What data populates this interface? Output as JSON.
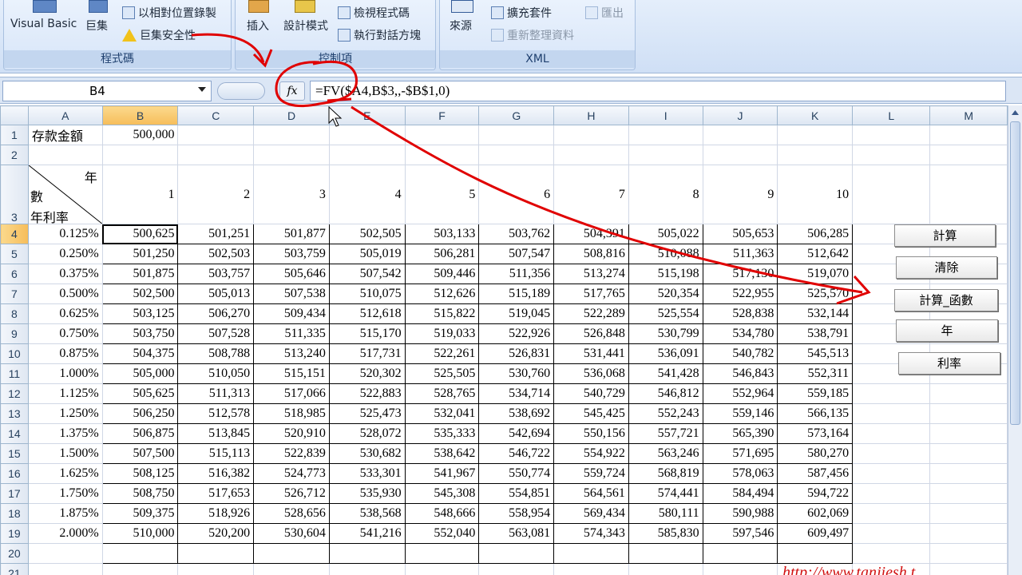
{
  "ribbon": {
    "code_group": {
      "label": "程式碼",
      "visual_basic": "Visual Basic",
      "macros": "巨集",
      "relative_record": "以相對位置錄製",
      "macro_security": "巨集安全性"
    },
    "controls_group": {
      "label": "控制項",
      "insert": "插入",
      "design_mode": "設計模式",
      "view_code": "檢視程式碼",
      "run_dialog": "執行對話方塊"
    },
    "xml_group": {
      "label": "XML",
      "source": "來源",
      "expansion_packs": "擴充套件",
      "refresh_data": "重新整理資料",
      "export": "匯出"
    }
  },
  "formula_bar": {
    "name_box": "B4",
    "fx_label": "fx",
    "formula": "=FV($A4,B$3,,-$B$1,0)"
  },
  "sheet": {
    "columns": [
      "A",
      "B",
      "C",
      "D",
      "E",
      "F",
      "G",
      "H",
      "I",
      "J",
      "K",
      "L",
      "M"
    ],
    "row1": {
      "label": "存款金額",
      "amount": "500,000"
    },
    "row3": {
      "year_label": "年",
      "years_label": "數",
      "rate_label": "年利率",
      "years": [
        "1",
        "2",
        "3",
        "4",
        "5",
        "6",
        "7",
        "8",
        "9",
        "10"
      ]
    },
    "rates": [
      "0.125%",
      "0.250%",
      "0.375%",
      "0.500%",
      "0.625%",
      "0.750%",
      "0.875%",
      "1.000%",
      "1.125%",
      "1.250%",
      "1.375%",
      "1.500%",
      "1.625%",
      "1.750%",
      "1.875%",
      "2.000%"
    ],
    "values": [
      [
        "500,625",
        "501,251",
        "501,877",
        "502,505",
        "503,133",
        "503,762",
        "504,391",
        "505,022",
        "505,653",
        "506,285"
      ],
      [
        "501,250",
        "502,503",
        "503,759",
        "505,019",
        "506,281",
        "507,547",
        "508,816",
        "510,088",
        "511,363",
        "512,642"
      ],
      [
        "501,875",
        "503,757",
        "505,646",
        "507,542",
        "509,446",
        "511,356",
        "513,274",
        "515,198",
        "517,130",
        "519,070"
      ],
      [
        "502,500",
        "505,013",
        "507,538",
        "510,075",
        "512,626",
        "515,189",
        "517,765",
        "520,354",
        "522,955",
        "525,570"
      ],
      [
        "503,125",
        "506,270",
        "509,434",
        "512,618",
        "515,822",
        "519,045",
        "522,289",
        "525,554",
        "528,838",
        "532,144"
      ],
      [
        "503,750",
        "507,528",
        "511,335",
        "515,170",
        "519,033",
        "522,926",
        "526,848",
        "530,799",
        "534,780",
        "538,791"
      ],
      [
        "504,375",
        "508,788",
        "513,240",
        "517,731",
        "522,261",
        "526,831",
        "531,441",
        "536,091",
        "540,782",
        "545,513"
      ],
      [
        "505,000",
        "510,050",
        "515,151",
        "520,302",
        "525,505",
        "530,760",
        "536,068",
        "541,428",
        "546,843",
        "552,311"
      ],
      [
        "505,625",
        "511,313",
        "517,066",
        "522,883",
        "528,765",
        "534,714",
        "540,729",
        "546,812",
        "552,964",
        "559,185"
      ],
      [
        "506,250",
        "512,578",
        "518,985",
        "525,473",
        "532,041",
        "538,692",
        "545,425",
        "552,243",
        "559,146",
        "566,135"
      ],
      [
        "506,875",
        "513,845",
        "520,910",
        "528,072",
        "535,333",
        "542,694",
        "550,156",
        "557,721",
        "565,390",
        "573,164"
      ],
      [
        "507,500",
        "515,113",
        "522,839",
        "530,682",
        "538,642",
        "546,722",
        "554,922",
        "563,246",
        "571,695",
        "580,270"
      ],
      [
        "508,125",
        "516,382",
        "524,773",
        "533,301",
        "541,967",
        "550,774",
        "559,724",
        "568,819",
        "578,063",
        "587,456"
      ],
      [
        "508,750",
        "517,653",
        "526,712",
        "535,930",
        "545,308",
        "554,851",
        "564,561",
        "574,441",
        "584,494",
        "594,722"
      ],
      [
        "509,375",
        "518,926",
        "528,656",
        "538,568",
        "548,666",
        "558,954",
        "569,434",
        "580,111",
        "590,988",
        "602,069"
      ],
      [
        "510,000",
        "520,200",
        "530,604",
        "541,216",
        "552,040",
        "563,081",
        "574,343",
        "585,830",
        "597,546",
        "609,497"
      ]
    ]
  },
  "buttons": {
    "calculate": "計算",
    "clear": "清除",
    "calc_function": "計算_函數",
    "year": "年",
    "rate": "利率"
  },
  "annotation": {
    "url": "http://www.tanjiesh.t..."
  },
  "colors": {
    "annotation_red": "#e00000",
    "selected_header": "#f6bd5a"
  }
}
